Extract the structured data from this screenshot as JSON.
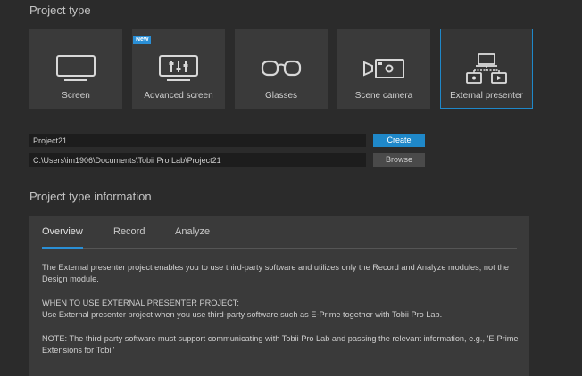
{
  "project_type": {
    "title": "Project type",
    "tiles": [
      {
        "label": "Screen",
        "icon": "monitor-icon",
        "badge": ""
      },
      {
        "label": "Advanced screen",
        "icon": "advanced-screen-icon",
        "badge": "New"
      },
      {
        "label": "Glasses",
        "icon": "glasses-icon",
        "badge": ""
      },
      {
        "label": "Scene camera",
        "icon": "scene-camera-icon",
        "badge": ""
      },
      {
        "label": "External presenter",
        "icon": "external-presenter-icon",
        "badge": ""
      }
    ],
    "selected": "External presenter"
  },
  "project": {
    "name_value": "Project21",
    "path_value": "C:\\Users\\im1906\\Documents\\Tobii Pro Lab\\Project21",
    "create_label": "Create",
    "browse_label": "Browse"
  },
  "info": {
    "title": "Project type information",
    "tabs": [
      "Overview",
      "Record",
      "Analyze"
    ],
    "active_tab": "Overview",
    "paragraphs": [
      "The External presenter project enables you to use third-party software and utilizes only the Record and Analyze modules, not the Design module.",
      "WHEN TO USE EXTERNAL PRESENTER PROJECT:",
      "Use External presenter project when you use third-party software such as E-Prime together with Tobii Pro Lab.",
      "NOTE: The third-party software must support communicating with Tobii Pro Lab and passing the relevant information, e.g., 'E-Prime Extensions for Tobii'"
    ]
  },
  "colors": {
    "accent": "#1f88c9",
    "background": "#2b2b2b",
    "tile": "#3a3a3a"
  }
}
